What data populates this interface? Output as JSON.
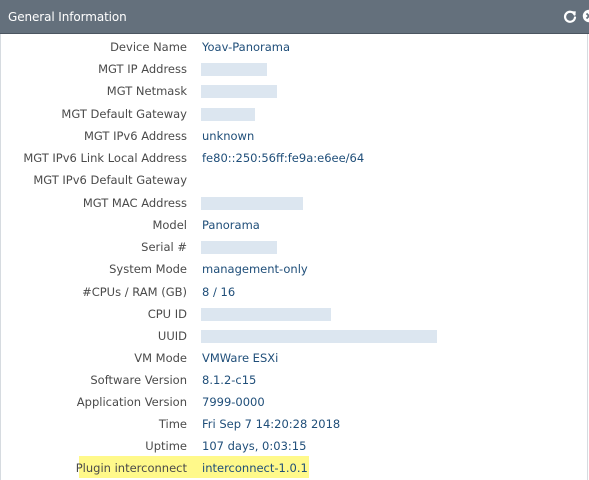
{
  "panel": {
    "title": "General Information",
    "refresh_icon": "refresh-icon",
    "close_icon": "close-icon"
  },
  "rows": [
    {
      "label": "Device Name",
      "value": "Yoav-Panorama"
    },
    {
      "label": "MGT IP Address",
      "value": ""
    },
    {
      "label": "MGT Netmask",
      "value": ""
    },
    {
      "label": "MGT Default Gateway",
      "value": ""
    },
    {
      "label": "MGT IPv6 Address",
      "value": "unknown"
    },
    {
      "label": "MGT IPv6 Link Local Address",
      "value": "fe80::250:56ff:fe9a:e6ee/64"
    },
    {
      "label": "MGT IPv6 Default Gateway",
      "value": ""
    },
    {
      "label": "MGT MAC Address",
      "value": ""
    },
    {
      "label": "Model",
      "value": "Panorama"
    },
    {
      "label": "Serial #",
      "value": ""
    },
    {
      "label": "System Mode",
      "value": "management-only"
    },
    {
      "label": "#CPUs / RAM (GB)",
      "value": "8 / 16"
    },
    {
      "label": "CPU ID",
      "value": ""
    },
    {
      "label": "UUID",
      "value": ""
    },
    {
      "label": "VM Mode",
      "value": "VMWare ESXi"
    },
    {
      "label": "Software Version",
      "value": "8.1.2-c15"
    },
    {
      "label": "Application Version",
      "value": "7999-0000"
    },
    {
      "label": "Time",
      "value": "Fri Sep 7 14:20:28 2018"
    },
    {
      "label": "Uptime",
      "value": "107 days, 0:03:15"
    },
    {
      "label": "Plugin interconnect",
      "value": "interconnect-1.0.1"
    }
  ],
  "colors": {
    "header_bg": "#64707c",
    "label_text": "#4a4a4a",
    "value_text": "#1f4e79",
    "masked_value": "#dce6f0",
    "highlight": "#fff98a"
  }
}
